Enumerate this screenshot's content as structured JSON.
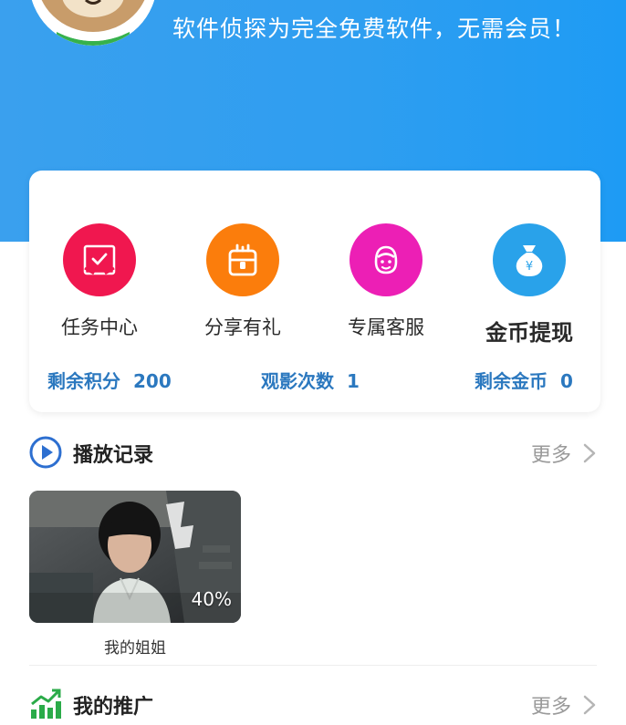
{
  "header": {
    "slogan": "软件侦探为完全免费软件，无需会员！",
    "background_color": "#2f9ef0"
  },
  "features": [
    {
      "label": "任务中心",
      "icon": "task-icon",
      "color": "#f0174f"
    },
    {
      "label": "分享有礼",
      "icon": "gift-icon",
      "color": "#fb7d0c"
    },
    {
      "label": "专属客服",
      "icon": "customer-service-icon",
      "color": "#ec1fb5"
    },
    {
      "label": "金币提现",
      "icon": "money-bag-icon",
      "color": "#29a2ea"
    }
  ],
  "stats": {
    "points_label": "剩余积分",
    "points_value": "200",
    "views_label": "观影次数",
    "views_value": "1",
    "coins_label": "剩余金币",
    "coins_value": "0"
  },
  "history": {
    "title": "播放记录",
    "more_label": "更多",
    "items": [
      {
        "title": "我的姐姐",
        "progress_label": "40%",
        "progress": 0.4
      }
    ]
  },
  "promotion": {
    "title": "我的推广",
    "more_label": "更多"
  }
}
